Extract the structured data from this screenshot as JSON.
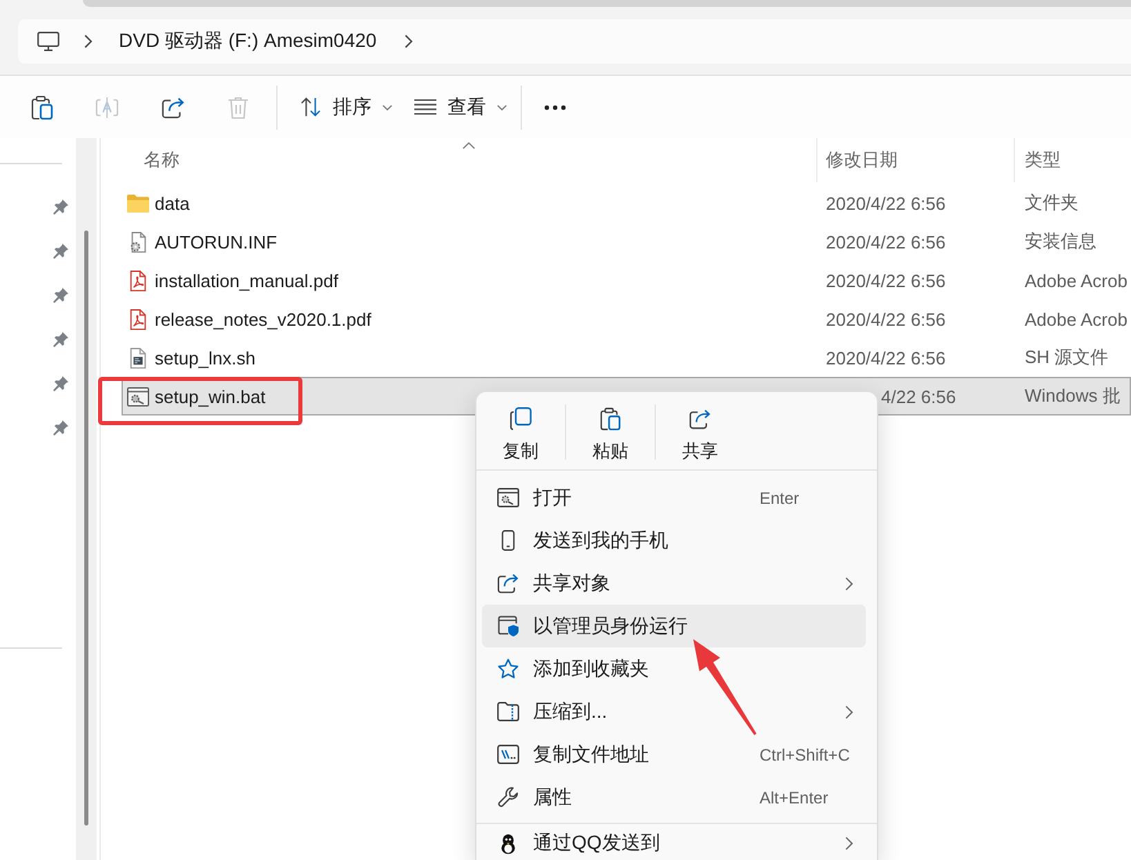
{
  "address_bar": {
    "path": [
      "DVD 驱动器 (F:) Amesim0420"
    ]
  },
  "toolbar": {
    "icon_buttons": [
      {
        "disabled": false
      },
      {
        "disabled": true
      },
      {
        "disabled": false
      },
      {
        "disabled": true
      }
    ],
    "dropdowns": [
      {
        "label": "排序"
      },
      {
        "label": "查看"
      }
    ]
  },
  "nav_pane": {
    "items": [
      {
        "pinned": true
      },
      {
        "pinned": true
      },
      {
        "pinned": true
      },
      {
        "pinned": true
      },
      {
        "pinned": true
      },
      {
        "pinned": true
      }
    ]
  },
  "file_list": {
    "columns": [
      {
        "label": "名称",
        "sorted": true
      },
      {
        "label": "修改日期",
        "sorted": false
      },
      {
        "label": "类型",
        "sorted": false
      }
    ],
    "rows": [
      {
        "kind": "folder",
        "name": "data",
        "modified": "2020/4/22 6:56",
        "type": "文件夹",
        "selected": false
      },
      {
        "kind": "config",
        "name": "AUTORUN.INF",
        "modified": "2020/4/22 6:56",
        "type": "安装信息",
        "selected": false
      },
      {
        "kind": "pdf",
        "name": "installation_manual.pdf",
        "modified": "2020/4/22 6:56",
        "type": "Adobe Acrob",
        "selected": false
      },
      {
        "kind": "pdf",
        "name": "release_notes_v2020.1.pdf",
        "modified": "2020/4/22 6:56",
        "type": "Adobe Acrob",
        "selected": false
      },
      {
        "kind": "script",
        "name": "setup_lnx.sh",
        "modified": "2020/4/22 6:56",
        "type": "SH 源文件",
        "selected": false
      },
      {
        "kind": "batch",
        "name": "setup_win.bat",
        "modified": "4/22 6:56",
        "type": "Windows 批",
        "selected": true
      }
    ]
  },
  "context_menu": {
    "actions": [
      {
        "label": "复制"
      },
      {
        "label": "粘贴"
      },
      {
        "label": "共享"
      }
    ],
    "sections": [
      {
        "items": [
          {
            "label": "打开",
            "shortcut": "Enter",
            "submenu": false,
            "selected": false
          },
          {
            "label": "发送到我的手机",
            "submenu": false,
            "selected": false
          },
          {
            "label": "共享对象",
            "submenu": true,
            "selected": false
          },
          {
            "label": "以管理员身份运行",
            "submenu": false,
            "selected": true
          },
          {
            "label": "添加到收藏夹",
            "submenu": false,
            "selected": false
          },
          {
            "label": "压缩到...",
            "submenu": true,
            "selected": false
          },
          {
            "label": "复制文件地址",
            "shortcut": "Ctrl+Shift+C",
            "submenu": false,
            "selected": false
          },
          {
            "label": "属性",
            "shortcut": "Alt+Enter",
            "submenu": false,
            "selected": false
          }
        ]
      },
      {
        "items": [
          {
            "label": "通过QQ发送到",
            "submenu": true,
            "selected": false
          }
        ]
      }
    ]
  }
}
